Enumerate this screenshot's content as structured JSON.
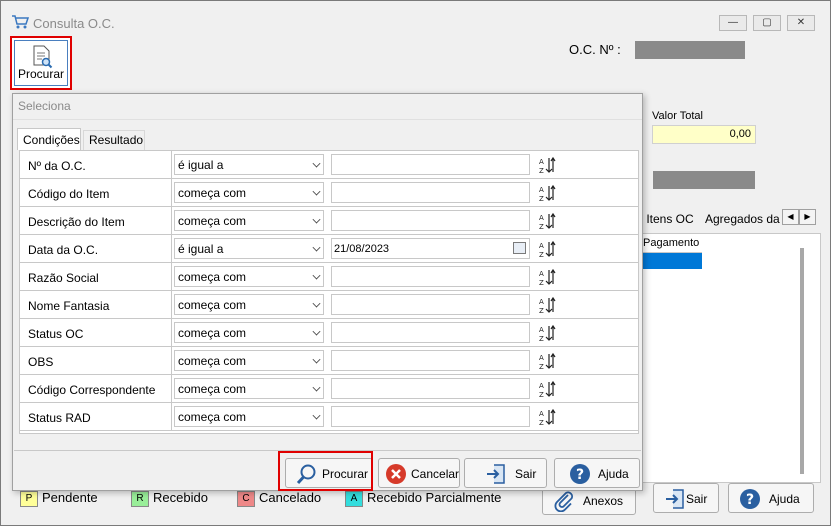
{
  "window": {
    "title": "Consulta O.C.",
    "min_label": "▭",
    "max_label": "▢",
    "close_label": "✕"
  },
  "toolbar": {
    "procurar_label": "Procurar"
  },
  "header": {
    "oc_label": "O.C. Nº :",
    "oc_value": ""
  },
  "right_panel": {
    "valor_total_label": "Valor Total",
    "valor_total_value": "0,00",
    "tabs": [
      "s Itens OC",
      "Agregados da"
    ],
    "grid_header": "Pagamento"
  },
  "legend": [
    {
      "key": "P",
      "label": "Pendente",
      "color": "#ffff99"
    },
    {
      "key": "R",
      "label": "Recebido",
      "color": "#99ee99"
    },
    {
      "key": "C",
      "label": "Cancelado",
      "color": "#ee8888"
    },
    {
      "key": "A",
      "label": "Recebido Parcialmente",
      "color": "#33dddd"
    }
  ],
  "bottom_buttons": {
    "anexos": "Anexos",
    "sair": "Sair",
    "ajuda": "Ajuda"
  },
  "dialog": {
    "title": "Seleciona",
    "tabs": [
      "Condições",
      "Resultado"
    ],
    "rows": [
      {
        "label": "Nº da O.C.",
        "operator": "é igual a",
        "value": ""
      },
      {
        "label": "Código do Item",
        "operator": "começa com",
        "value": ""
      },
      {
        "label": "Descrição do Item",
        "operator": "começa com",
        "value": ""
      },
      {
        "label": "Data da O.C.",
        "operator": "é igual a",
        "value": "21/08/2023"
      },
      {
        "label": "Razão Social",
        "operator": "começa com",
        "value": ""
      },
      {
        "label": "Nome Fantasia",
        "operator": "começa com",
        "value": ""
      },
      {
        "label": "Status OC",
        "operator": "começa com",
        "value": ""
      },
      {
        "label": "OBS",
        "operator": "começa com",
        "value": ""
      },
      {
        "label": "Código Correspondente",
        "operator": "começa com",
        "value": ""
      },
      {
        "label": "Status RAD",
        "operator": "começa com",
        "value": ""
      }
    ],
    "buttons": {
      "procurar": "Procurar",
      "cancelar": "Cancelar",
      "sair": "Sair",
      "ajuda": "Ajuda"
    }
  }
}
